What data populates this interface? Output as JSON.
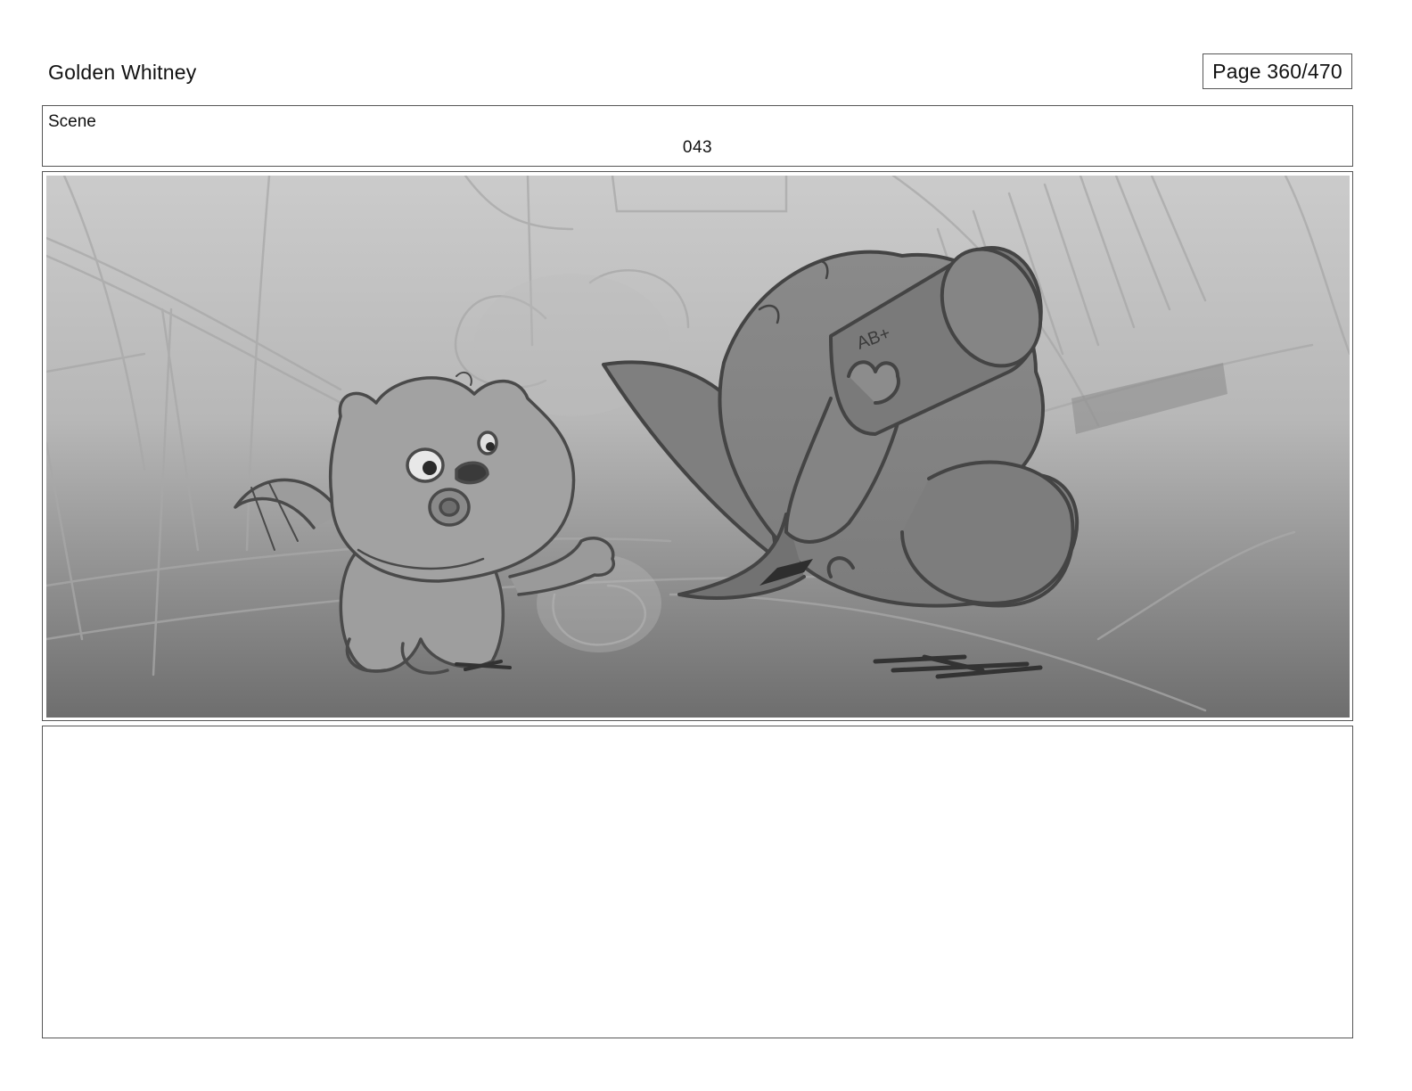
{
  "header": {
    "project_title": "Golden Whitney",
    "page_label": "Page 360/470"
  },
  "scene": {
    "label": "Scene",
    "number": "043"
  },
  "panel": {
    "sketch_text": "AB+"
  },
  "notes": {
    "text": ""
  }
}
